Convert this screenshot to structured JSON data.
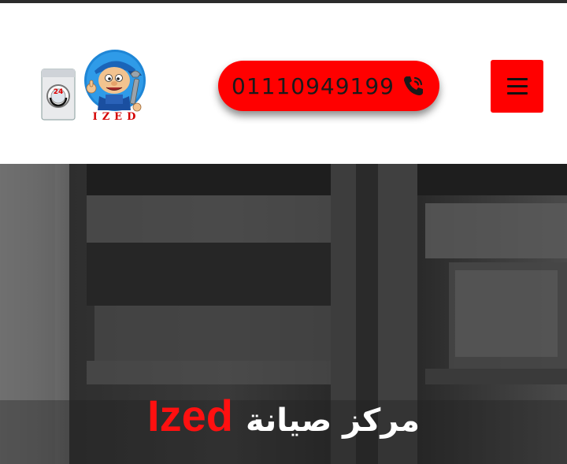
{
  "header": {
    "logo": {
      "icon": "repair-mascot-logo-icon",
      "brand_text": "IZED",
      "badge": "24"
    },
    "phone": {
      "number": "01110949199",
      "icon": "phone-call-icon"
    },
    "menu": {
      "icon": "hamburger-menu-icon"
    }
  },
  "hero": {
    "title_text": "مركز صيانة",
    "title_brand": "Ized"
  },
  "colors": {
    "accent": "#ff0000",
    "header_bg": "#ffffff",
    "hero_bg": "#333333",
    "hero_text": "#ffffff"
  }
}
